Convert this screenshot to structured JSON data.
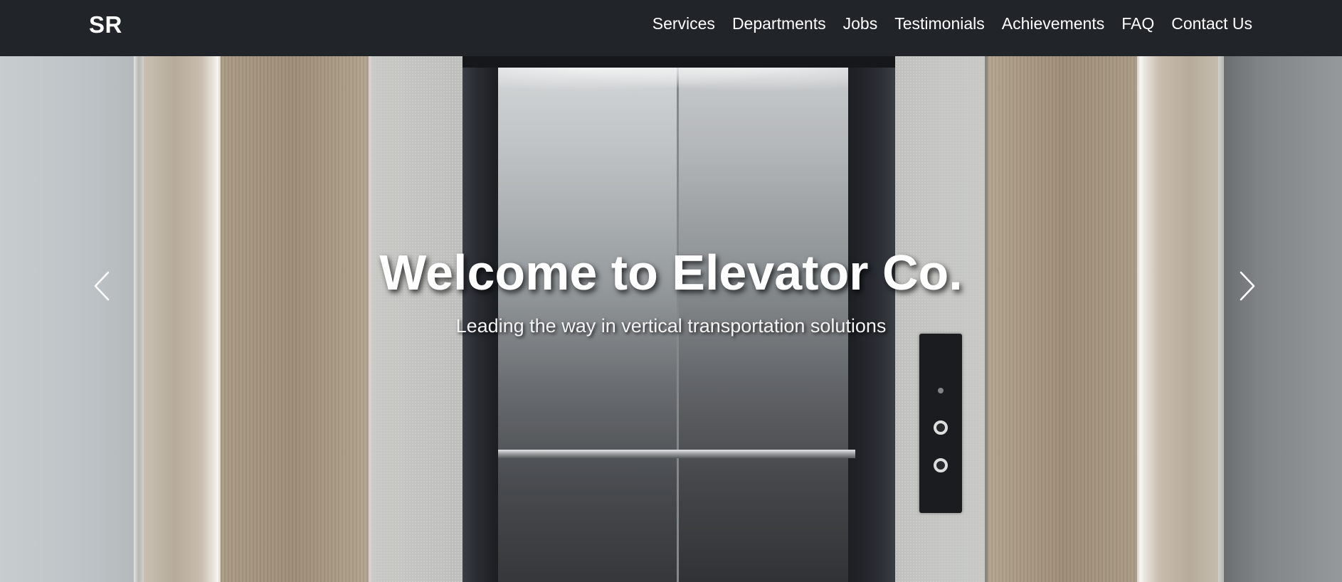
{
  "navbar": {
    "brand": "SR",
    "links": [
      {
        "label": "Services"
      },
      {
        "label": "Departments"
      },
      {
        "label": "Jobs"
      },
      {
        "label": "Testimonials"
      },
      {
        "label": "Achievements"
      },
      {
        "label": "FAQ"
      },
      {
        "label": "Contact Us"
      }
    ]
  },
  "hero": {
    "title": "Welcome to Elevator Co.",
    "subtitle": "Leading the way in vertical transportation solutions",
    "prev_icon": "chevron-left-icon",
    "next_icon": "chevron-right-icon"
  },
  "colors": {
    "navbar_bg": "#212529",
    "nav_text": "#ffffff"
  }
}
